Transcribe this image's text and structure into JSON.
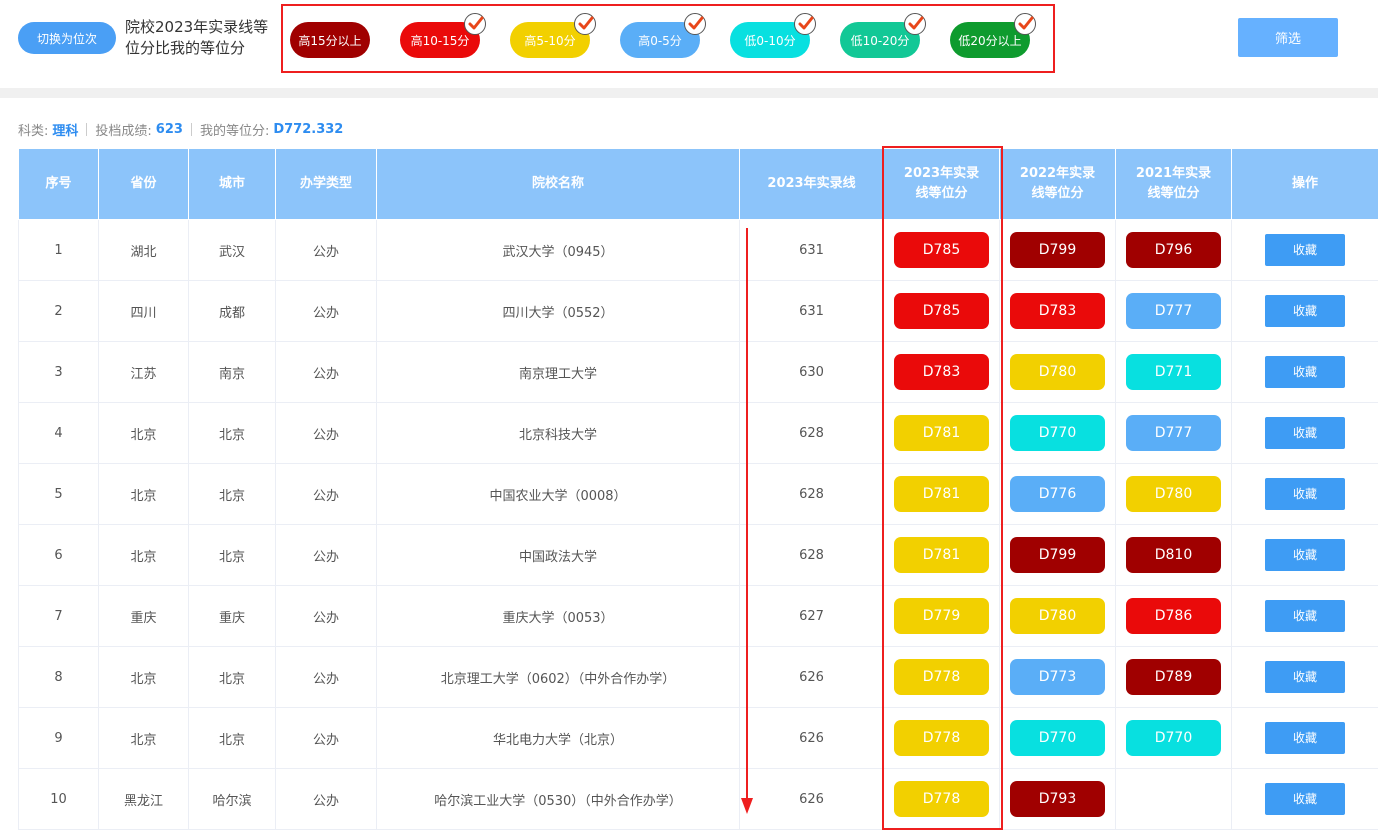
{
  "header": {
    "switch_label": "切换为位次",
    "caption": "院校2023年实录线等位分比我的等位分",
    "filter_button": "筛选"
  },
  "filters": [
    {
      "label": "高15分以上",
      "color": "#a00000",
      "checked": false
    },
    {
      "label": "高10-15分",
      "color": "#ea0a0a",
      "checked": true
    },
    {
      "label": "高5-10分",
      "color": "#f2d000",
      "checked": true
    },
    {
      "label": "高0-5分",
      "color": "#5aaef7",
      "checked": true
    },
    {
      "label": "低0-10分",
      "color": "#08e0e0",
      "checked": true
    },
    {
      "label": "低10-20分",
      "color": "#12c896",
      "checked": true
    },
    {
      "label": "低20分以上",
      "color": "#0e9b2e",
      "checked": true
    }
  ],
  "info": {
    "subject_label": "科类:",
    "subject_value": "理科",
    "score_label": "投档成绩:",
    "score_value": "623",
    "rank_label": "我的等位分:",
    "rank_value": "D772.332"
  },
  "colors": {
    "dark_red": "#a00000",
    "red": "#ea0a0a",
    "yellow": "#f2d000",
    "blue": "#5aaef7",
    "cyan": "#08e0e0",
    "annotation_red": "#ee1f1f"
  },
  "table": {
    "headers": [
      "序号",
      "省份",
      "城市",
      "办学类型",
      "院校名称",
      "2023年实录线",
      "2023年实录线等位分",
      "2022年实录线等位分",
      "2021年实录线等位分",
      "操作"
    ],
    "action_label": "收藏",
    "rows": [
      {
        "no": "1",
        "province": "湖北",
        "city": "武汉",
        "type": "公办",
        "name": "武汉大学（0945）",
        "line": "631",
        "s23": "D785",
        "c23": "red",
        "s22": "D799",
        "c22": "dark_red",
        "s21": "D796",
        "c21": "dark_red"
      },
      {
        "no": "2",
        "province": "四川",
        "city": "成都",
        "type": "公办",
        "name": "四川大学（0552）",
        "line": "631",
        "s23": "D785",
        "c23": "red",
        "s22": "D783",
        "c22": "red",
        "s21": "D777",
        "c21": "blue"
      },
      {
        "no": "3",
        "province": "江苏",
        "city": "南京",
        "type": "公办",
        "name": "南京理工大学",
        "line": "630",
        "s23": "D783",
        "c23": "red",
        "s22": "D780",
        "c22": "yellow",
        "s21": "D771",
        "c21": "cyan"
      },
      {
        "no": "4",
        "province": "北京",
        "city": "北京",
        "type": "公办",
        "name": "北京科技大学",
        "line": "628",
        "s23": "D781",
        "c23": "yellow",
        "s22": "D770",
        "c22": "cyan",
        "s21": "D777",
        "c21": "blue"
      },
      {
        "no": "5",
        "province": "北京",
        "city": "北京",
        "type": "公办",
        "name": "中国农业大学（0008）",
        "line": "628",
        "s23": "D781",
        "c23": "yellow",
        "s22": "D776",
        "c22": "blue",
        "s21": "D780",
        "c21": "yellow"
      },
      {
        "no": "6",
        "province": "北京",
        "city": "北京",
        "type": "公办",
        "name": "中国政法大学",
        "line": "628",
        "s23": "D781",
        "c23": "yellow",
        "s22": "D799",
        "c22": "dark_red",
        "s21": "D810",
        "c21": "dark_red"
      },
      {
        "no": "7",
        "province": "重庆",
        "city": "重庆",
        "type": "公办",
        "name": "重庆大学（0053）",
        "line": "627",
        "s23": "D779",
        "c23": "yellow",
        "s22": "D780",
        "c22": "yellow",
        "s21": "D786",
        "c21": "red"
      },
      {
        "no": "8",
        "province": "北京",
        "city": "北京",
        "type": "公办",
        "name": "北京理工大学（0602）（中外合作办学）",
        "line": "626",
        "s23": "D778",
        "c23": "yellow",
        "s22": "D773",
        "c22": "blue",
        "s21": "D789",
        "c21": "dark_red"
      },
      {
        "no": "9",
        "province": "北京",
        "city": "北京",
        "type": "公办",
        "name": "华北电力大学（北京）",
        "line": "626",
        "s23": "D778",
        "c23": "yellow",
        "s22": "D770",
        "c22": "cyan",
        "s21": "D770",
        "c21": "cyan"
      },
      {
        "no": "10",
        "province": "黑龙江",
        "city": "哈尔滨",
        "type": "公办",
        "name": "哈尔滨工业大学（0530）（中外合作办学）",
        "line": "626",
        "s23": "D778",
        "c23": "yellow",
        "s22": "D793",
        "c22": "dark_red",
        "s21": "",
        "c21": ""
      }
    ]
  }
}
